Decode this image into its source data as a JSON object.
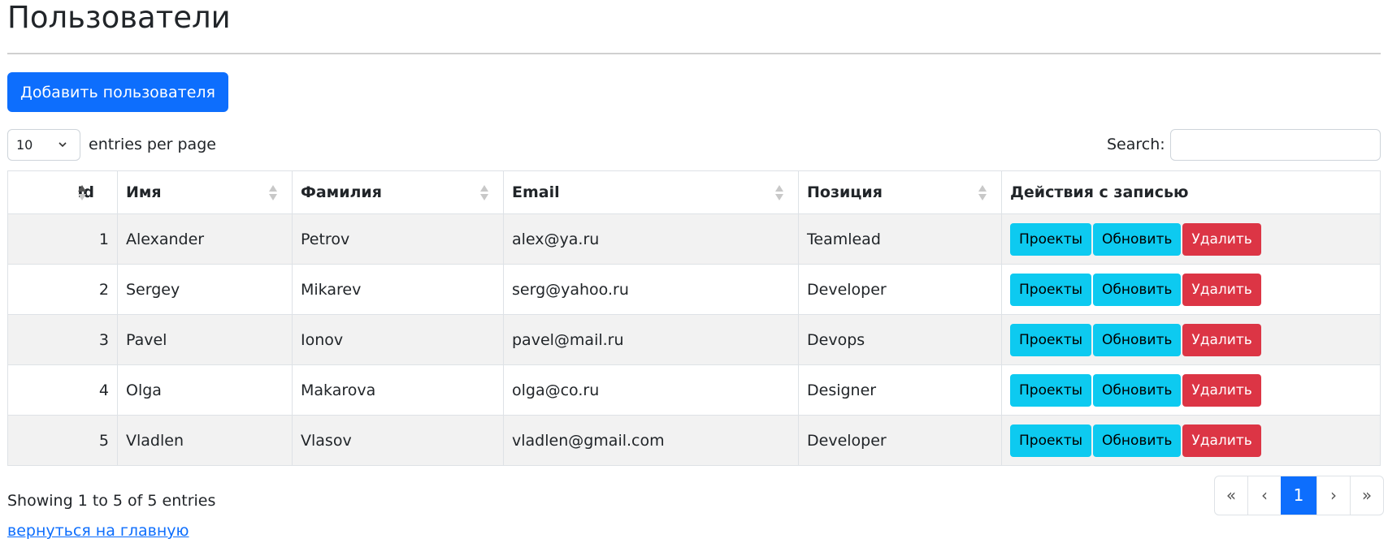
{
  "page": {
    "title": "Пользователи"
  },
  "toolbar": {
    "add_label": "Добавить пользователя"
  },
  "controls": {
    "per_page_value": "10",
    "per_page_label": "entries per page",
    "search_label": "Search:",
    "search_value": ""
  },
  "table": {
    "headers": {
      "id": "Id",
      "first_name": "Имя",
      "last_name": "Фамилия",
      "email": "Email",
      "position": "Позиция",
      "actions": "Действия с записью"
    },
    "actions": {
      "projects": "Проекты",
      "update": "Обновить",
      "delete": "Удалить"
    },
    "rows": [
      {
        "id": "1",
        "first_name": "Alexander",
        "last_name": "Petrov",
        "email": "alex@ya.ru",
        "position": "Teamlead"
      },
      {
        "id": "2",
        "first_name": "Sergey",
        "last_name": "Mikarev",
        "email": "serg@yahoo.ru",
        "position": "Developer"
      },
      {
        "id": "3",
        "first_name": "Pavel",
        "last_name": "Ionov",
        "email": "pavel@mail.ru",
        "position": "Devops"
      },
      {
        "id": "4",
        "first_name": "Olga",
        "last_name": "Makarova",
        "email": "olga@co.ru",
        "position": "Designer"
      },
      {
        "id": "5",
        "first_name": "Vladlen",
        "last_name": "Vlasov",
        "email": "vladlen@gmail.com",
        "position": "Developer"
      }
    ]
  },
  "footer": {
    "info": "Showing 1 to 5 of 5 entries",
    "back_link": "вернуться на главную"
  },
  "pagination": {
    "first": "«",
    "prev": "‹",
    "current": "1",
    "next": "›",
    "last": "»"
  },
  "colors": {
    "primary": "#0d6efd",
    "info": "#0dcaf0",
    "danger": "#dc3545",
    "stripe": "#f2f2f2"
  }
}
